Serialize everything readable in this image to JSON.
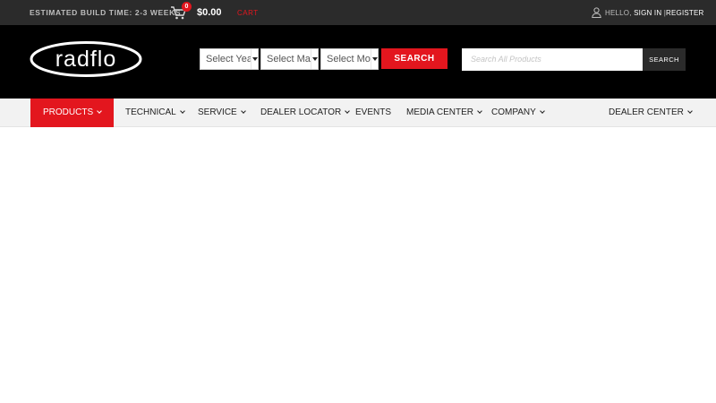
{
  "topbar": {
    "build_time": "ESTIMATED BUILD TIME: 2-3 WEEKS",
    "cart_count": "0",
    "cart_total": "$0.00",
    "cart_label": "CART",
    "greeting": "HELLO,",
    "sign_in": "SIGN IN",
    "separator": "|",
    "register": "REGISTER"
  },
  "header": {
    "logo_text": "radflo",
    "selects": [
      {
        "selected": "Select Year"
      },
      {
        "selected": "Select Make"
      },
      {
        "selected": "Select Model"
      }
    ],
    "search_label": "SEARCH",
    "product_search_placeholder": "Search All Products",
    "product_search_button": "SEARCH"
  },
  "nav": {
    "items": [
      {
        "label": "PRODUCTS",
        "dropdown": true,
        "active": true
      },
      {
        "label": "TECHNICAL",
        "dropdown": true
      },
      {
        "label": "SERVICE",
        "dropdown": true
      },
      {
        "label": "DEALER LOCATOR",
        "dropdown": true
      },
      {
        "label": "EVENTS",
        "dropdown": false
      },
      {
        "label": "MEDIA CENTER",
        "dropdown": true
      },
      {
        "label": "COMPANY",
        "dropdown": true
      },
      {
        "label": "DEALER CENTER",
        "dropdown": true
      }
    ]
  },
  "colors": {
    "brand_red": "#e3161e",
    "topbar_bg": "#2b2b2b",
    "header_bg": "#000000",
    "nav_bg": "#f2f2f2"
  },
  "icons": {
    "cart": "cart-icon",
    "user": "user-icon",
    "chevron": "chevron-down-icon"
  }
}
